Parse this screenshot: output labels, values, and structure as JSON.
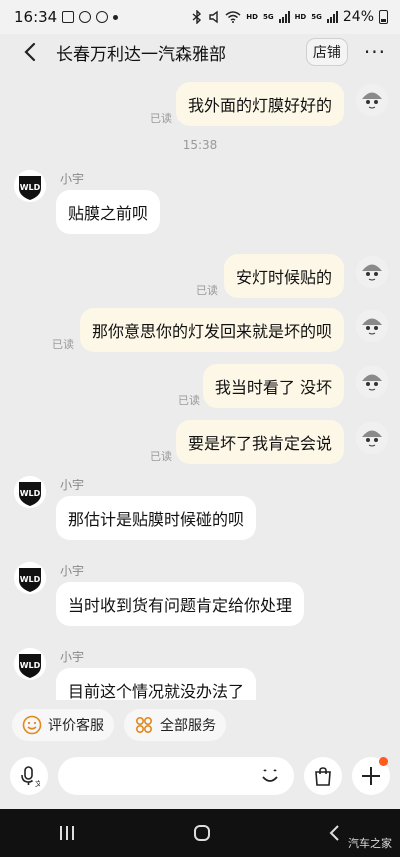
{
  "status_bar": {
    "time": "16:34",
    "net1": "HD",
    "net2": "5G",
    "net3": "HD",
    "net4": "5G",
    "battery": "24%"
  },
  "header": {
    "title": "长春万利达一汽森雅部",
    "shop_label": "店铺",
    "more_label": "···"
  },
  "messages": [
    {
      "dir": "out",
      "text": "我外面的灯膜好好的",
      "read": "已读"
    },
    {
      "timestamp": "15:38"
    },
    {
      "dir": "in",
      "sender": "小宇",
      "avatar_text": "WLD",
      "text": "贴膜之前呗"
    },
    {
      "dir": "out",
      "text": "安灯时候贴的",
      "read": "已读"
    },
    {
      "dir": "out",
      "text": "那你意思你的灯发回来就是坏的呗",
      "read": "已读"
    },
    {
      "dir": "out",
      "text": "我当时看了 没坏",
      "read": "已读"
    },
    {
      "dir": "out",
      "text": "要是坏了我肯定会说",
      "read": "已读"
    },
    {
      "dir": "in",
      "sender": "小宇",
      "avatar_text": "WLD",
      "text": "那估计是贴膜时候碰的呗"
    },
    {
      "dir": "in",
      "sender": "小宇",
      "avatar_text": "WLD",
      "text": "当时收到货有问题肯定给你处理"
    },
    {
      "dir": "in",
      "sender": "小宇",
      "avatar_text": "WLD",
      "text": "目前这个情况就没办法了"
    }
  ],
  "quick_actions": [
    {
      "label": "评价客服",
      "icon": "smile-icon"
    },
    {
      "label": "全部服务",
      "icon": "services-icon"
    }
  ],
  "watermark": "汽车之家",
  "colors": {
    "out_bubble": "#fdf7e7",
    "in_bubble": "#ffffff",
    "background": "#ececec",
    "badge": "#ff5a1f"
  }
}
